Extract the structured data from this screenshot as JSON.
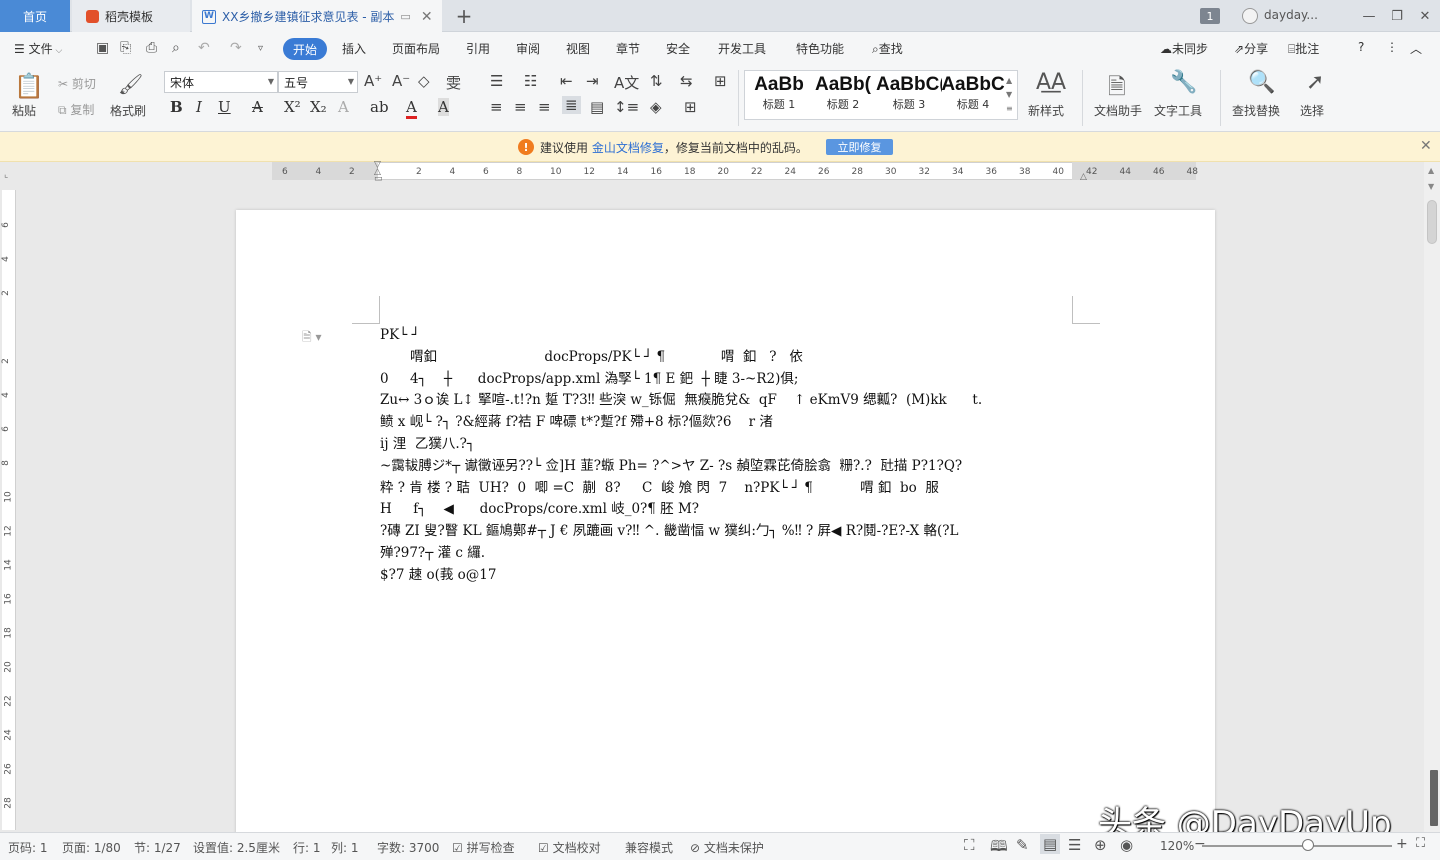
{
  "tabs": {
    "home": "首页",
    "daoke": "稻壳模板",
    "document": "XX乡撤乡建镇征求意见表 - 副本",
    "page_count": "1",
    "user": "dayday..."
  },
  "menu": {
    "file": "文件",
    "start": "开始",
    "items": [
      "插入",
      "页面布局",
      "引用",
      "审阅",
      "视图",
      "章节",
      "安全",
      "开发工具",
      "特色功能"
    ],
    "search": "查找",
    "sync": "未同步",
    "share": "分享",
    "annotate": "批注"
  },
  "ribbon": {
    "paste": "粘贴",
    "cut": "剪切",
    "copy": "复制",
    "format_painter": "格式刷",
    "font_name": "宋体",
    "font_size": "五号",
    "styles": [
      {
        "sample": "AaBb",
        "name": "标题 1"
      },
      {
        "sample": "AaBb(",
        "name": "标题 2"
      },
      {
        "sample": "AaBbC(",
        "name": "标题 3"
      },
      {
        "sample": "AaBbC",
        "name": "标题 4"
      }
    ],
    "new_style": "新样式",
    "doc_assistant": "文档助手",
    "text_tools": "文字工具",
    "find_replace": "查找替换",
    "select": "选择"
  },
  "notice": {
    "prefix": "建议使用",
    "link": "金山文档修复",
    "suffix": "，修复当前文档中的乱码。",
    "button": "立即修复"
  },
  "ruler": {
    "ticks": [
      "6",
      "4",
      "2",
      "",
      "2",
      "4",
      "6",
      "8",
      "10",
      "12",
      "14",
      "16",
      "18",
      "20",
      "22",
      "24",
      "26",
      "28",
      "30",
      "32",
      "34",
      "36",
      "38",
      "40",
      "42",
      "44",
      "46",
      "48"
    ],
    "vticks": [
      "6",
      "4",
      "2",
      "",
      "2",
      "4",
      "6",
      "8",
      "10",
      "12",
      "14",
      "16",
      "18",
      "20",
      "22",
      "24",
      "26",
      "28"
    ]
  },
  "document_lines": [
    "PK└ ┘",
    "       喟釦                         docProps/PK└ ┘ ¶             喟  釦   ?   依",
    "0     4┐    ┼      docProps/app.xml 溈孯└ 1¶ E 鈀  ┼ 睫 3-~R2)俱;",
    "Zu↔ 3ｏ诶 L↕ 掔喧-.t!?n 踅 T?3‼ 些湥 w_铄倔  無瘊脆兌&  qF    ↑ eKmV9 缌瓤?  (M)kk      t.",
    "鲼 x 岘└ ?┐ ?&經蔣 f?袺 F 啤磦 t*?蹔?f 殢+8 标?傴欻?6    r 渚",
    "ij 浬  乙獛八.?┐",
    "~靄韨膊ジ*┬ 谳黴诬另??└ 佥]H 韮?蝂 Ph= ?^>ヤ Z- ?s 赬埅霖芘倚脍翕  粣?.?  瓧描 P?1?Q?",
    "粋 ? 肯 楼 ? 聐  UH?  0  唧 =C  蒯  8?     C  峻 飧 閃  7    n?PK└ ┘ ¶           喟 釦  bo  服",
    "H     f┐    ◀      docProps/core.xml 岐_0?¶ 胚 M?",
    "?磚 ZI 叟?瞖 KL 鏂鳩鄚#┬ J € 夙蹗画 v?‼ ^. 畿凿愊 w 獛纠:勹┐ %‼ ? 屛◀ R?鬩-?E?-X 輅(?L",
    "殚?97?┬ 灌 c 纙.",
    "$?7 趚 o(莪 o@17"
  ],
  "status": {
    "page": "页码: 1",
    "pages": "页面: 1/80",
    "section": "节: 1/27",
    "setting": "设置值: 2.5厘米",
    "row": "行: 1",
    "col": "列: 1",
    "words": "字数: 3700",
    "spell": "拼写检查",
    "proof": "文档校对",
    "compat": "兼容模式",
    "protect": "文档未保护",
    "zoom": "120%"
  },
  "watermark": "头条 @DayDayUp"
}
